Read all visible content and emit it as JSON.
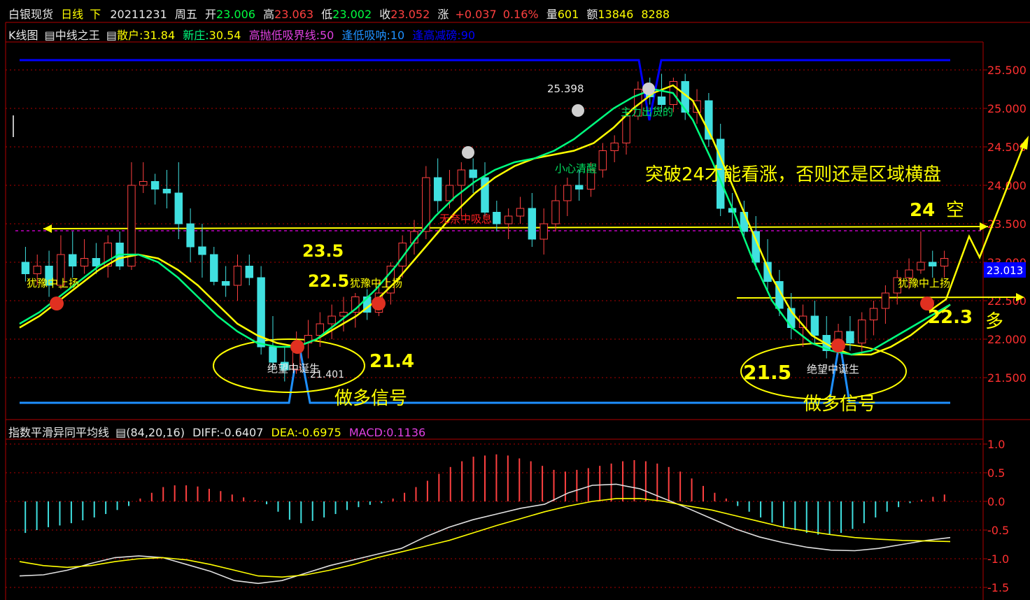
{
  "header": {
    "instrument": "白银现货",
    "period": "日线",
    "dir": "下",
    "date": "20211231",
    "weekday": "周五",
    "open_label": "开",
    "open": "23.006",
    "high_label": "高",
    "high": "23.063",
    "low_label": "低",
    "low": "23.002",
    "close_label": "收",
    "close": "23.052",
    "change_label": "涨",
    "change": "+0.037",
    "change_pct": "0.16%",
    "vol_label": "量",
    "vol": "601",
    "amt_label": "额",
    "amt": "13846",
    "amt2": "8288"
  },
  "indicator_bar": {
    "chart_name": "K线图",
    "indicator": "中线之王",
    "retail_label": "散户:",
    "retail": "31.84",
    "dealer_label": "新庄:",
    "dealer": "30.54",
    "line1": "高抛低吸界线:50",
    "line2": "逢低吸呐:10",
    "line3": "逢高减磅:90"
  },
  "macd_bar": {
    "name": "指数平滑异同平均线",
    "params": "(84,20,16)",
    "diff_label": "DIFF:",
    "diff": "-0.6407",
    "dea_label": "DEA:",
    "dea": "-0.6975",
    "macd_label": "MACD:",
    "macd": "0.1136"
  },
  "colors": {
    "background": "#000000",
    "axis": "#b00000",
    "up": "#ff4040",
    "down": "#40e0e0",
    "annotation": "#ffff00",
    "retail_line": "#ffff00",
    "dealer_line": "#00ff7f",
    "boundary_high": "#0000ff",
    "boundary_low": "#1e90ff",
    "cross_line": "#c000c0"
  },
  "chart_data": [
    {
      "type": "candlestick",
      "title": "白银现货 日线",
      "y_ticks": [
        "25.500",
        "25.000",
        "24.500",
        "24.000",
        "23.500",
        "23.000",
        "22.500",
        "22.000",
        "21.500"
      ],
      "ylim": [
        21.2,
        25.8
      ],
      "current_price_label": "23.013",
      "candles_ohlc": [
        [
          23.0,
          23.2,
          22.75,
          22.85
        ],
        [
          22.85,
          23.1,
          22.7,
          22.95
        ],
        [
          22.95,
          23.15,
          22.55,
          22.7
        ],
        [
          22.7,
          23.35,
          22.65,
          23.1
        ],
        [
          23.1,
          23.4,
          22.8,
          22.95
        ],
        [
          22.95,
          23.3,
          22.85,
          23.05
        ],
        [
          23.05,
          23.25,
          22.85,
          22.95
        ],
        [
          22.95,
          23.35,
          22.8,
          23.25
        ],
        [
          23.25,
          23.4,
          22.9,
          22.95
        ],
        [
          22.95,
          24.3,
          22.9,
          24.0
        ],
        [
          24.0,
          24.3,
          23.9,
          24.05
        ],
        [
          24.05,
          24.15,
          23.75,
          23.95
        ],
        [
          23.95,
          24.2,
          23.7,
          23.9
        ],
        [
          23.9,
          24.3,
          23.3,
          23.5
        ],
        [
          23.5,
          23.7,
          23.0,
          23.2
        ],
        [
          23.2,
          23.5,
          22.8,
          23.1
        ],
        [
          23.1,
          23.2,
          22.7,
          22.75
        ],
        [
          22.75,
          22.95,
          22.55,
          22.7
        ],
        [
          22.7,
          23.1,
          22.5,
          22.95
        ],
        [
          22.95,
          23.1,
          22.7,
          22.8
        ],
        [
          22.8,
          22.95,
          21.8,
          21.9
        ],
        [
          21.9,
          22.3,
          21.6,
          21.7
        ],
        [
          21.7,
          21.9,
          21.45,
          21.6
        ],
        [
          21.6,
          22.1,
          21.55,
          21.95
        ],
        [
          21.95,
          22.25,
          21.75,
          22.05
        ],
        [
          22.05,
          22.35,
          21.9,
          22.2
        ],
        [
          22.2,
          22.45,
          22.0,
          22.3
        ],
        [
          22.3,
          22.55,
          22.1,
          22.35
        ],
        [
          22.35,
          22.6,
          22.15,
          22.55
        ],
        [
          22.55,
          22.65,
          22.25,
          22.35
        ],
        [
          22.35,
          22.75,
          22.3,
          22.6
        ],
        [
          22.6,
          23.0,
          22.45,
          22.95
        ],
        [
          22.95,
          23.35,
          22.8,
          23.25
        ],
        [
          23.25,
          23.55,
          23.1,
          23.4
        ],
        [
          23.4,
          24.25,
          23.3,
          24.1
        ],
        [
          24.1,
          24.35,
          23.65,
          23.8
        ],
        [
          23.8,
          24.2,
          23.7,
          24.0
        ],
        [
          24.0,
          24.3,
          23.6,
          24.2
        ],
        [
          24.2,
          24.35,
          23.9,
          24.1
        ],
        [
          24.1,
          24.3,
          23.6,
          23.65
        ],
        [
          23.65,
          23.8,
          23.4,
          23.5
        ],
        [
          23.5,
          23.7,
          23.3,
          23.6
        ],
        [
          23.6,
          23.85,
          23.5,
          23.7
        ],
        [
          23.7,
          23.9,
          23.2,
          23.3
        ],
        [
          23.3,
          23.7,
          23.1,
          23.5
        ],
        [
          23.5,
          24.0,
          23.4,
          23.8
        ],
        [
          23.8,
          24.1,
          23.6,
          24.0
        ],
        [
          24.0,
          24.2,
          23.8,
          23.95
        ],
        [
          23.95,
          24.3,
          23.85,
          24.2
        ],
        [
          24.2,
          24.55,
          24.1,
          24.45
        ],
        [
          24.45,
          24.65,
          24.3,
          24.55
        ],
        [
          24.55,
          24.95,
          24.4,
          24.9
        ],
        [
          24.9,
          25.35,
          24.85,
          25.25
        ],
        [
          25.25,
          25.4,
          25.05,
          25.15
        ],
        [
          25.15,
          25.45,
          24.95,
          25.05
        ],
        [
          25.05,
          25.4,
          24.95,
          25.35
        ],
        [
          25.35,
          25.45,
          24.85,
          24.95
        ],
        [
          24.95,
          25.25,
          24.8,
          25.1
        ],
        [
          25.1,
          25.2,
          24.5,
          24.6
        ],
        [
          24.6,
          24.8,
          23.6,
          23.7
        ],
        [
          23.7,
          23.9,
          23.45,
          23.65
        ],
        [
          23.65,
          23.8,
          23.3,
          23.4
        ],
        [
          23.4,
          23.6,
          22.9,
          23.0
        ],
        [
          23.0,
          23.3,
          22.6,
          22.75
        ],
        [
          22.75,
          22.9,
          22.3,
          22.4
        ],
        [
          22.4,
          22.6,
          22.0,
          22.15
        ],
        [
          22.15,
          22.45,
          21.9,
          22.3
        ],
        [
          22.3,
          22.5,
          21.95,
          22.05
        ],
        [
          22.05,
          22.3,
          21.75,
          21.85
        ],
        [
          21.85,
          22.2,
          21.8,
          22.1
        ],
        [
          22.1,
          22.3,
          21.85,
          21.95
        ],
        [
          21.95,
          22.35,
          21.8,
          22.25
        ],
        [
          22.25,
          22.5,
          22.05,
          22.4
        ],
        [
          22.4,
          22.7,
          22.2,
          22.6
        ],
        [
          22.6,
          22.9,
          22.45,
          22.8
        ],
        [
          22.8,
          23.05,
          22.65,
          22.9
        ],
        [
          22.9,
          23.4,
          22.85,
          23.0
        ],
        [
          23.0,
          23.15,
          22.8,
          22.95
        ],
        [
          22.95,
          23.15,
          22.8,
          23.05
        ]
      ],
      "series": [
        {
          "name": "散户",
          "values": [
            22.15,
            22.3,
            22.5,
            22.7,
            22.9,
            23.05,
            23.1,
            23.05,
            22.9,
            22.7,
            22.45,
            22.2,
            22.05,
            21.95,
            21.9,
            22.0,
            22.15,
            22.3,
            22.5,
            22.75,
            23.05,
            23.35,
            23.65,
            23.9,
            24.1,
            24.25,
            24.35,
            24.4,
            24.45,
            24.55,
            24.75,
            25.0,
            25.2,
            25.3,
            25.1,
            24.6,
            24.0,
            23.4,
            22.8,
            22.35,
            22.05,
            21.9,
            21.8,
            21.8,
            21.9,
            22.05,
            22.25,
            22.45
          ]
        },
        {
          "name": "新庄",
          "values": [
            22.2,
            22.35,
            22.55,
            22.75,
            22.95,
            23.1,
            23.1,
            23.0,
            22.8,
            22.55,
            22.3,
            22.1,
            21.95,
            21.9,
            21.9,
            22.0,
            22.2,
            22.4,
            22.65,
            22.95,
            23.3,
            23.6,
            23.85,
            24.05,
            24.2,
            24.3,
            24.35,
            24.45,
            24.6,
            24.8,
            25.0,
            25.15,
            25.25,
            25.2,
            24.85,
            24.3,
            23.7,
            23.05,
            22.5,
            22.15,
            21.95,
            21.85,
            21.8,
            21.85,
            22.0,
            22.15,
            22.3,
            22.45
          ]
        }
      ],
      "annotations": {
        "left_labels": [
          "犹豫中上扬",
          "犹豫中上扬",
          "犹豫中上扬"
        ],
        "gong": "25.398",
        "low_label": "21.401",
        "mid_labels": [
          "小心清醒",
          "无奈中吸息",
          "主力出货的"
        ],
        "despair": [
          "绝望中诞生",
          "绝望中诞生"
        ],
        "levels": [
          "23.5",
          "22.5",
          "21.4",
          "21.5",
          "24",
          "空",
          "22.3",
          "多"
        ],
        "signals": [
          "做多信号",
          "做多信号"
        ],
        "headline": "突破24才能看涨，否则还是区域横盘"
      }
    },
    {
      "type": "bar",
      "title": "指数平滑异同平均线 (84,20,16)",
      "y_ticks": [
        "1.0",
        "0.5",
        "0.0",
        "-0.5",
        "-1.0",
        "-1.5"
      ],
      "ylim": [
        -1.5,
        1.0
      ],
      "histogram": [
        -0.55,
        -0.5,
        -0.45,
        -0.42,
        -0.38,
        -0.33,
        -0.28,
        -0.22,
        -0.15,
        -0.08,
        0.05,
        0.15,
        0.25,
        0.28,
        0.28,
        0.26,
        0.22,
        0.18,
        0.12,
        0.07,
        0.02,
        -0.05,
        -0.18,
        -0.32,
        -0.38,
        -0.34,
        -0.28,
        -0.22,
        -0.15,
        -0.1,
        -0.06,
        -0.03,
        0.05,
        0.15,
        0.25,
        0.36,
        0.48,
        0.6,
        0.7,
        0.78,
        0.8,
        0.82,
        0.8,
        0.75,
        0.7,
        0.62,
        0.55,
        0.52,
        0.55,
        0.58,
        0.62,
        0.66,
        0.7,
        0.72,
        0.7,
        0.66,
        0.6,
        0.52,
        0.4,
        0.27,
        0.15,
        0.05,
        -0.08,
        -0.18,
        -0.28,
        -0.37,
        -0.44,
        -0.5,
        -0.55,
        -0.58,
        -0.58,
        -0.55,
        -0.48,
        -0.38,
        -0.28,
        -0.18,
        -0.1,
        -0.03,
        0.03,
        0.08,
        0.12
      ],
      "series": [
        {
          "name": "DIFF",
          "values": [
            -1.3,
            -1.28,
            -1.2,
            -1.08,
            -0.98,
            -0.95,
            -0.98,
            -1.1,
            -1.22,
            -1.38,
            -1.43,
            -1.38,
            -1.25,
            -1.12,
            -1.02,
            -0.92,
            -0.82,
            -0.62,
            -0.45,
            -0.32,
            -0.22,
            -0.12,
            -0.05,
            0.15,
            0.28,
            0.3,
            0.22,
            0.05,
            -0.12,
            -0.3,
            -0.48,
            -0.62,
            -0.72,
            -0.8,
            -0.85,
            -0.86,
            -0.82,
            -0.75,
            -0.68,
            -0.63
          ]
        },
        {
          "name": "DEA",
          "values": [
            -1.05,
            -1.12,
            -1.15,
            -1.12,
            -1.05,
            -1.0,
            -0.98,
            -1.02,
            -1.1,
            -1.2,
            -1.3,
            -1.32,
            -1.28,
            -1.2,
            -1.1,
            -0.98,
            -0.88,
            -0.78,
            -0.68,
            -0.55,
            -0.42,
            -0.3,
            -0.18,
            -0.08,
            0.0,
            0.05,
            0.05,
            0.0,
            -0.08,
            -0.15,
            -0.25,
            -0.35,
            -0.45,
            -0.52,
            -0.58,
            -0.63,
            -0.66,
            -0.68,
            -0.69,
            -0.7
          ]
        }
      ]
    }
  ]
}
